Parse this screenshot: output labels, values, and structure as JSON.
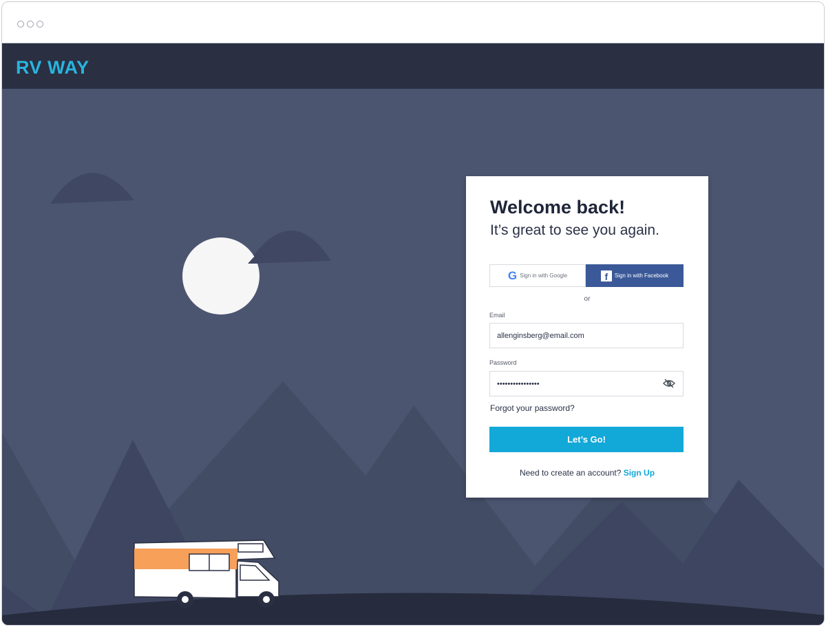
{
  "app": {
    "brand": "RV WAY"
  },
  "icons": {
    "window_dots": "window-dots-icon",
    "google": "google-icon",
    "facebook": "facebook-icon",
    "eye": "eye-slash-icon"
  },
  "login": {
    "title": "Welcome back!",
    "subtitle": "It’s great to see you again.",
    "google_label": "Sign in with Google",
    "facebook_label": "Sign in with Facebook",
    "or_label": "or",
    "email_label": "Email",
    "email_value": "allenginsberg@email.com",
    "password_label": "Password",
    "password_value": "••••••••••••••••",
    "forgot_label": "Forgot your password?",
    "submit_label": "Let’s Go!",
    "signup_prompt": "Need to create an account? ",
    "signup_link": "Sign Up"
  },
  "colors": {
    "accent": "#12a8d8",
    "brand": "#28b4de",
    "header_bg": "#2a2f42",
    "scene_bg": "#4b5570",
    "facebook": "#3b5998",
    "rv_stripe": "#f6a05a"
  }
}
